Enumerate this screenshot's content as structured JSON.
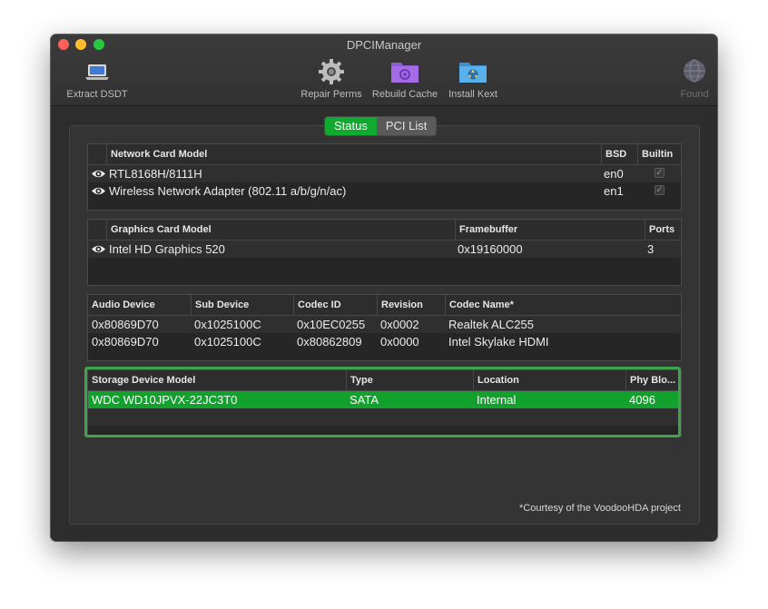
{
  "window": {
    "title": "DPCIManager"
  },
  "toolbar": {
    "items": [
      {
        "label": "Extract DSDT",
        "icon": "laptop-icon"
      },
      {
        "label": "Repair Perms",
        "icon": "gear-icon"
      },
      {
        "label": "Rebuild Cache",
        "icon": "folder-gear-icon"
      },
      {
        "label": "Install Kext",
        "icon": "folder-kext-icon"
      },
      {
        "label": "Found",
        "icon": "globe-icon"
      }
    ]
  },
  "tabs": {
    "status": "Status",
    "pci_list": "PCI List",
    "selected": "Status"
  },
  "network": {
    "headers": [
      "Network Card Model",
      "BSD",
      "Builtin"
    ],
    "rows": [
      {
        "model": "RTL8168H/8111H",
        "bsd": "en0",
        "builtin": true
      },
      {
        "model": "Wireless Network Adapter (802.11 a/b/g/n/ac)",
        "bsd": "en1",
        "builtin": true
      }
    ]
  },
  "graphics": {
    "headers": [
      "Graphics Card Model",
      "Framebuffer",
      "Ports"
    ],
    "rows": [
      {
        "model": "Intel HD Graphics 520",
        "framebuffer": "0x19160000",
        "ports": "3"
      }
    ]
  },
  "audio": {
    "headers": [
      "Audio Device",
      "Sub Device",
      "Codec ID",
      "Revision",
      "Codec Name*"
    ],
    "rows": [
      {
        "device": "0x80869D70",
        "sub": "0x1025100C",
        "codec_id": "0x10EC0255",
        "revision": "0x0002",
        "codec_name": "Realtek ALC255"
      },
      {
        "device": "0x80869D70",
        "sub": "0x1025100C",
        "codec_id": "0x80862809",
        "revision": "0x0000",
        "codec_name": "Intel Skylake HDMI"
      }
    ]
  },
  "storage": {
    "headers": [
      "Storage Device Model",
      "Type",
      "Location",
      "Phy Blo..."
    ],
    "rows": [
      {
        "model": "WDC WD10JPVX-22JC3T0",
        "type": "SATA",
        "location": "Internal",
        "block": "4096"
      }
    ]
  },
  "footnote": "*Courtesy of the VoodooHDA project",
  "colors": {
    "accent": "#12a12c",
    "highlight_border": "#3fa24c",
    "window_bg": "#2d2d2d"
  }
}
